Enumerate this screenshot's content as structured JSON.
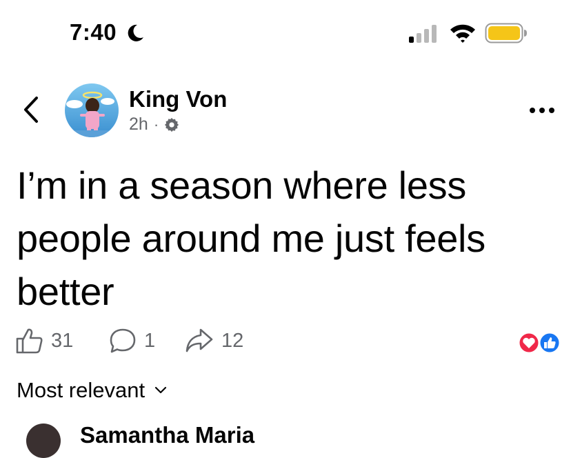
{
  "status_bar": {
    "time": "7:40",
    "icons": [
      "moon-icon",
      "signal-icon",
      "wifi-icon",
      "battery-icon"
    ],
    "battery_color": "#f5c518"
  },
  "post": {
    "author": "King Von",
    "time_ago": "2h",
    "meta_separator": "·",
    "privacy_icon": "gear-icon",
    "text": "I’m in a season where less people around me just feels better",
    "likes": "31",
    "comments": "1",
    "shares": "12",
    "reactions": [
      "love",
      "like"
    ],
    "reaction_colors": {
      "love": "#f02849",
      "like": "#1877f2"
    }
  },
  "comments_section": {
    "sort_label": "Most relevant",
    "first_comment_author": "Samantha Maria"
  },
  "colors": {
    "text": "#050505",
    "secondary_text": "#65676b"
  }
}
